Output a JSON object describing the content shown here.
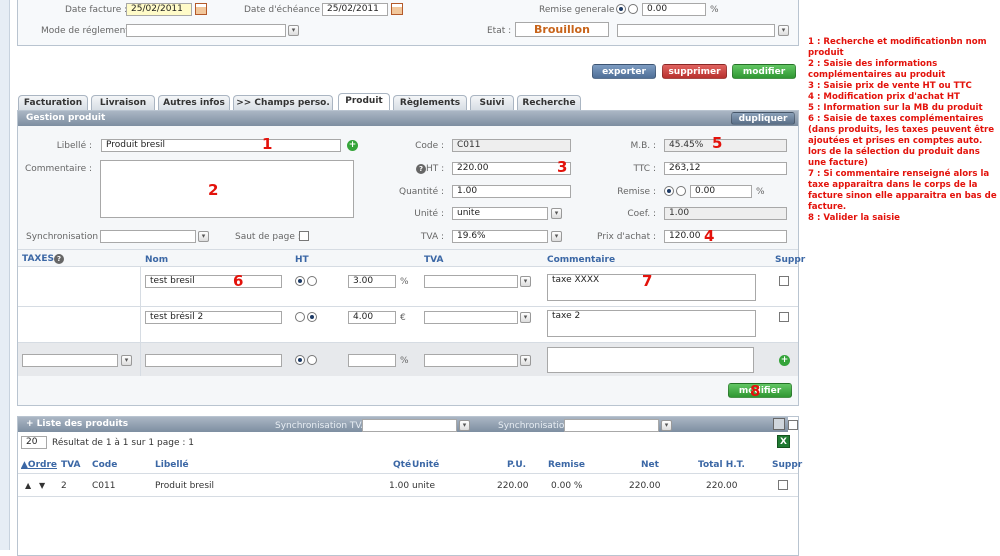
{
  "header": {
    "date_facture_label": "Date facture :",
    "date_facture_value": "25/02/2011",
    "date_echeance_label": "Date d'échéance :",
    "date_echeance_value": "25/02/2011",
    "remise_generale_label": "Remise generale :",
    "remise_generale_value": "0.00",
    "percent": "%",
    "mode_reglement_label": "Mode de réglement :",
    "mode_reglement_value": "",
    "etat_label": "Etat :",
    "etat_value": "Brouillon",
    "etat_extra_value": ""
  },
  "actions": {
    "exporter": "exporter",
    "supprimer": "supprimer",
    "modifier": "modifier"
  },
  "tabs": [
    {
      "label": "Facturation"
    },
    {
      "label": "Livraison"
    },
    {
      "label": "Autres infos"
    },
    {
      "label": ">> Champs perso."
    },
    {
      "label": "Produit"
    },
    {
      "label": "Règlements"
    },
    {
      "label": "Suivi"
    },
    {
      "label": "Recherche"
    }
  ],
  "gestion": {
    "title": "Gestion produit",
    "dupliquer": "dupliquer",
    "libelle_label": "Libellé :",
    "libelle_value": "Produit bresil",
    "commentaire_label": "Commentaire :",
    "commentaire_value": "",
    "code_label": "Code :",
    "code_value": "C011",
    "ht_label": "HT :",
    "ht_value": "220.00",
    "quantite_label": "Quantité :",
    "quantite_value": "1.00",
    "unite_label": "Unité :",
    "unite_value": "unite",
    "tva_label": "TVA :",
    "tva_value": "19.6%",
    "mb_label": "M.B. :",
    "mb_value": "45.45%",
    "ttc_label": "TTC :",
    "ttc_value": "263,12",
    "remise_label": "Remise :",
    "remise_value": "0.00",
    "coef_label": "Coef. :",
    "coef_value": "1.00",
    "prix_achat_label": "Prix d'achat :",
    "prix_achat_value": "120.00",
    "synchro_label": "Synchronisation :",
    "synchro_value": "",
    "saut_label": "Saut de page :",
    "percent": "%"
  },
  "taxes": {
    "title": "TAXES",
    "col_nom": "Nom",
    "col_ht": "HT",
    "col_tva": "TVA",
    "col_commentaire": "Commentaire",
    "col_suppr": "Suppr",
    "rows": [
      {
        "nom": "test bresil",
        "value": "3.00",
        "unit": "%",
        "tva": "",
        "commentaire": "taxe XXXX"
      },
      {
        "nom": "test brésil 2",
        "value": "4.00",
        "unit": "€",
        "tva": "",
        "commentaire": "taxe 2"
      }
    ],
    "new_unit": "%",
    "modifier": "modifier"
  },
  "liste": {
    "title": "+ Liste des produits",
    "sync_tva_label": "Synchronisation TVA :",
    "sync_label": "Synchronisation :",
    "per_page": "20",
    "resultat": "Résultat de 1 à 1 sur 1",
    "page": "page : 1",
    "columns": [
      "Ordre",
      "TVA",
      "Code",
      "Libellé",
      "Qté",
      "Unité",
      "P.U.",
      "Remise",
      "Net",
      "Total H.T.",
      "Suppr"
    ],
    "rows": [
      {
        "tva": "2",
        "code": "C011",
        "libelle": "Produit bresil",
        "qte": "1.00",
        "unite": "unite",
        "pu": "220.00",
        "remise": "0.00 %",
        "net": "220.00",
        "total": "220.00"
      }
    ]
  },
  "annotations": {
    "markers": [
      "1",
      "2",
      "3",
      "4",
      "5",
      "6",
      "7",
      "8"
    ],
    "notes": [
      "1 : Recherche et modificationbn nom produit",
      "2 : Saisie des informations complémentaires au produit",
      "3 : Saisie prix de vente HT ou TTC",
      "4 : Modification prix d'achat HT",
      "5 : Information sur la MB du produit",
      "6 : Saisie de taxes complémentaires (dans produits, les taxes peuvent être ajoutées et prises en comptes auto. lors de la sélection du produit dans une facture)",
      "7 : Si commentaire renseigné alors la taxe apparaitra dans le corps de la facture sinon elle apparaitra en bas de facture.",
      "8 : Valider la saisie"
    ]
  },
  "colors": {
    "accent": "#3b67a5",
    "annotation": "#e3120b",
    "exporter": "#5b7fa8",
    "supprimer": "#c9302c",
    "modifier": "#3aa53c"
  }
}
